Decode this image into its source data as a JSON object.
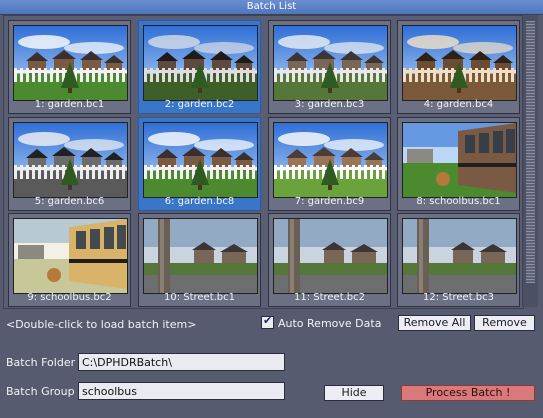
{
  "window": {
    "title": "Batch List"
  },
  "batch_items": [
    {
      "label": "1: garden.bc1",
      "style": "vivid",
      "scene": "garden"
    },
    {
      "label": "2: garden.bc2",
      "style": "dark",
      "scene": "garden"
    },
    {
      "label": "3: garden.bc3",
      "style": "natural",
      "scene": "garden"
    },
    {
      "label": "4: garden.bc4",
      "style": "sepia",
      "scene": "garden"
    },
    {
      "label": "5: garden.bc6",
      "style": "bw",
      "scene": "garden"
    },
    {
      "label": "6: garden.bc8",
      "style": "vivid",
      "scene": "garden"
    },
    {
      "label": "7: garden.bc9",
      "style": "bright",
      "scene": "garden"
    },
    {
      "label": "8: schoolbus.bc1",
      "style": "vivid",
      "scene": "bus"
    },
    {
      "label": "9: schoolbus.bc2",
      "style": "washed",
      "scene": "bus"
    },
    {
      "label": "10: Street.bc1",
      "style": "natural",
      "scene": "street"
    },
    {
      "label": "11: Street.bc2",
      "style": "natural",
      "scene": "street"
    },
    {
      "label": "12: Street.bc3",
      "style": "natural",
      "scene": "street"
    }
  ],
  "selected_items": [
    "2: garden.bc2",
    "6: garden.bc8"
  ],
  "hint": "<Double-click to load batch item>",
  "auto_remove": {
    "label": "Auto Remove Data",
    "checked": true
  },
  "buttons": {
    "remove_all": "Remove All",
    "remove": "Remove",
    "hide": "Hide",
    "process": "Process Batch !"
  },
  "batch_folder": {
    "label": "Batch Folder",
    "value": "C:\\DPHDRBatch\\"
  },
  "batch_group": {
    "label": "Batch Group",
    "value": "schoolbus"
  },
  "colors": {
    "background": "#575b70",
    "selection": "#3a76c8",
    "title_bar": "#4e75bf",
    "process_button": "#d97979"
  }
}
